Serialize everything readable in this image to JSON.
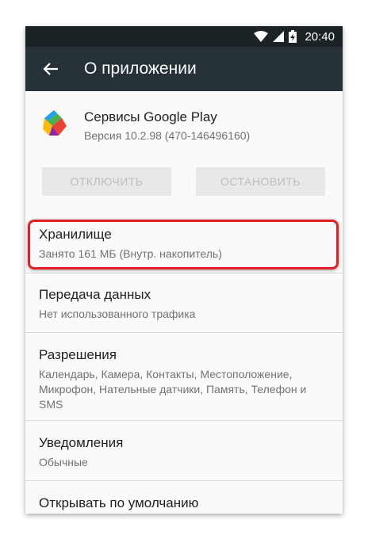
{
  "status_bar": {
    "time": "20:40"
  },
  "app_bar": {
    "title": "О приложении"
  },
  "app": {
    "name": "Сервисы Google Play",
    "version": "Версия 10.2.98 (470-146496160)"
  },
  "buttons": {
    "disable": "ОТКЛЮЧИТЬ",
    "stop": "ОСТАНОВИТЬ"
  },
  "items": [
    {
      "title": "Хранилище",
      "subtitle": "Занято 161 МБ (Внутр. накопитель)"
    },
    {
      "title": "Передача данных",
      "subtitle": "Нет использованного трафика"
    },
    {
      "title": "Разрешения",
      "subtitle": "Календарь, Камера, Контакты, Местоположение, Микрофон, Нательные датчики, Память, Телефон и SMS"
    },
    {
      "title": "Уведомления",
      "subtitle": "Обычные"
    },
    {
      "title": "Открывать по умолчанию",
      "subtitle": ""
    }
  ],
  "colors": {
    "status_bar": "#1b2327",
    "app_bar": "#263238",
    "highlight": "#e41e26"
  }
}
